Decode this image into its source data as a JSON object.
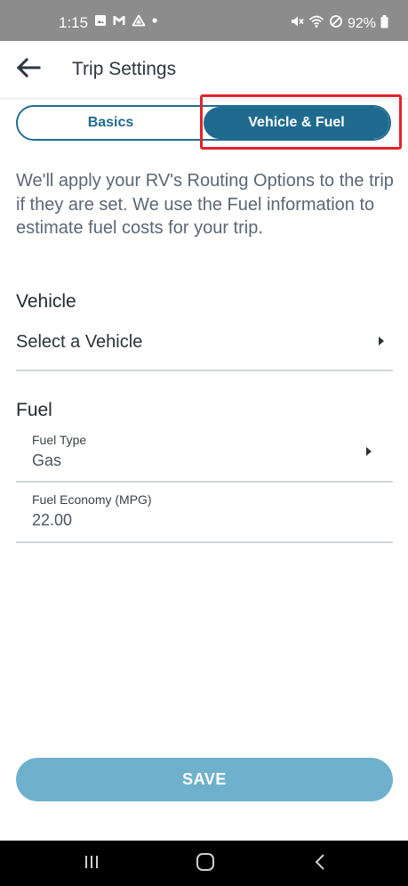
{
  "status_bar": {
    "time": "1:15",
    "battery_percent": "92%",
    "left_icons": [
      "image-icon",
      "gmail-icon",
      "drive-icon",
      "dot-icon"
    ],
    "right_icons": [
      "mute-icon",
      "wifi-call-icon",
      "do-not-disturb-icon",
      "battery-icon"
    ]
  },
  "header": {
    "title": "Trip Settings",
    "back_icon": "arrow-left-icon"
  },
  "tabs": {
    "basics_label": "Basics",
    "vehicle_fuel_label": "Vehicle & Fuel",
    "selected": "Vehicle & Fuel"
  },
  "description": "We'll apply your RV's Routing Options to the trip if they are set. We use the Fuel information to estimate fuel costs for your trip.",
  "vehicle_section": {
    "header": "Vehicle",
    "select_label": "Select a Vehicle"
  },
  "fuel_section": {
    "header": "Fuel",
    "fuel_type_label": "Fuel Type",
    "fuel_type_value": "Gas",
    "fuel_economy_label": "Fuel Economy (MPG)",
    "fuel_economy_value": "22.00"
  },
  "save_label": "SAVE",
  "colors": {
    "primary": "#1f6b90",
    "save_button": "#6fb1cc",
    "highlight": "#e3232b",
    "status_bar": "#8c8c8c"
  },
  "nav_bar": {
    "icons": [
      "recent-apps-icon",
      "home-icon",
      "back-icon"
    ]
  }
}
